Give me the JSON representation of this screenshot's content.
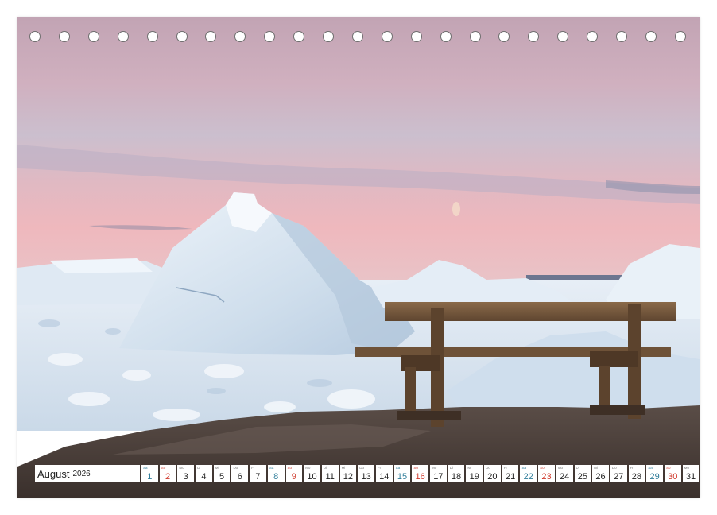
{
  "calendar": {
    "month": "August",
    "year": "2026",
    "days": [
      {
        "n": "1",
        "w": "Sa",
        "t": "sat"
      },
      {
        "n": "2",
        "w": "So",
        "t": "sun"
      },
      {
        "n": "3",
        "w": "Mo",
        "t": ""
      },
      {
        "n": "4",
        "w": "Di",
        "t": ""
      },
      {
        "n": "5",
        "w": "Mi",
        "t": ""
      },
      {
        "n": "6",
        "w": "Do",
        "t": ""
      },
      {
        "n": "7",
        "w": "Fr",
        "t": ""
      },
      {
        "n": "8",
        "w": "Sa",
        "t": "sat"
      },
      {
        "n": "9",
        "w": "So",
        "t": "sun"
      },
      {
        "n": "10",
        "w": "Mo",
        "t": ""
      },
      {
        "n": "11",
        "w": "Di",
        "t": ""
      },
      {
        "n": "12",
        "w": "Mi",
        "t": ""
      },
      {
        "n": "13",
        "w": "Do",
        "t": ""
      },
      {
        "n": "14",
        "w": "Fr",
        "t": ""
      },
      {
        "n": "15",
        "w": "Sa",
        "t": "sat"
      },
      {
        "n": "16",
        "w": "So",
        "t": "sun"
      },
      {
        "n": "17",
        "w": "Mo",
        "t": ""
      },
      {
        "n": "18",
        "w": "Di",
        "t": ""
      },
      {
        "n": "19",
        "w": "Mi",
        "t": ""
      },
      {
        "n": "20",
        "w": "Do",
        "t": ""
      },
      {
        "n": "21",
        "w": "Fr",
        "t": ""
      },
      {
        "n": "22",
        "w": "Sa",
        "t": "sat"
      },
      {
        "n": "23",
        "w": "So",
        "t": "sun"
      },
      {
        "n": "24",
        "w": "Mo",
        "t": ""
      },
      {
        "n": "25",
        "w": "Di",
        "t": ""
      },
      {
        "n": "26",
        "w": "Mi",
        "t": ""
      },
      {
        "n": "27",
        "w": "Do",
        "t": ""
      },
      {
        "n": "28",
        "w": "Fr",
        "t": ""
      },
      {
        "n": "29",
        "w": "Sa",
        "t": "sat"
      },
      {
        "n": "30",
        "w": "So",
        "t": "sun"
      },
      {
        "n": "31",
        "w": "Mo",
        "t": ""
      }
    ]
  },
  "colors": {
    "saturday": "#2f7d9a",
    "sunday": "#d0392c",
    "sky_top": "#c9a9b8",
    "ice": "#dfe9f2"
  }
}
